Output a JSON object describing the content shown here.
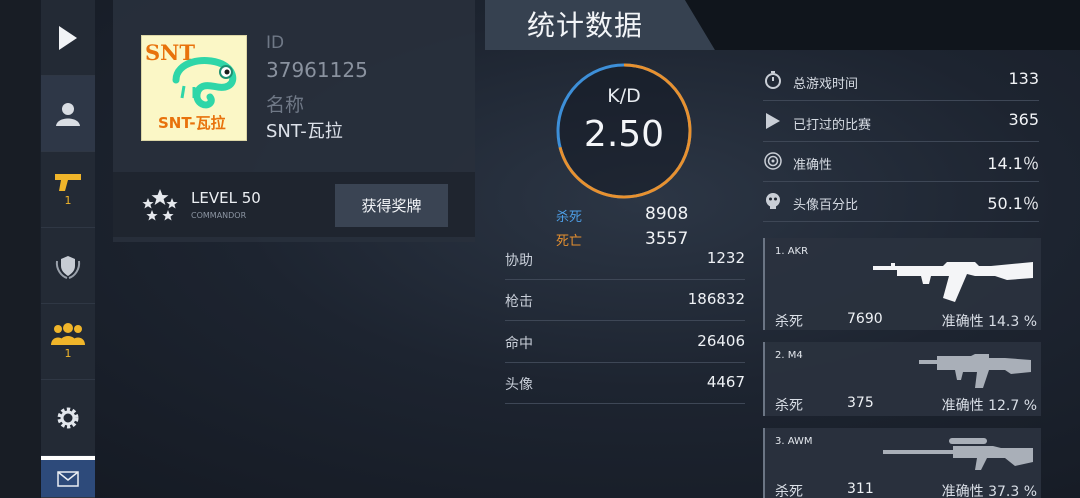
{
  "sidebar": {
    "play_icon": "play-icon",
    "profile_icon": "user-icon",
    "weapons_count": "1",
    "clan_count": "1",
    "settings_icon": "gear-icon",
    "mail_icon": "mail-icon"
  },
  "profile": {
    "logo_text": "SNT",
    "logo_sub": "SNT-瓦拉",
    "id_label": "ID",
    "id_value": "37961125",
    "name_label": "名称",
    "name_value": "SNT-瓦拉",
    "level": "LEVEL 50",
    "rank": "COMMANDOR",
    "award_button": "获得奖牌"
  },
  "stats": {
    "title": "统计数据",
    "kd_label": "K/D",
    "kd_value": "2.50",
    "kd_fraction": 0.71,
    "kills_label": "杀死",
    "kills_value": "8908",
    "deaths_label": "死亡",
    "deaths_value": "3557",
    "rows": [
      {
        "label": "协助",
        "value": "1232"
      },
      {
        "label": "枪击",
        "value": "186832"
      },
      {
        "label": "命中",
        "value": "26406"
      },
      {
        "label": "头像",
        "value": "4467"
      }
    ],
    "summary": [
      {
        "label": "总游戏时间",
        "value": "133",
        "icon": "stopwatch-icon"
      },
      {
        "label": "已打过的比赛",
        "value": "365",
        "icon": "play-icon"
      },
      {
        "label": "准确性",
        "value": "14.1％",
        "icon": "target-icon"
      },
      {
        "label": "头像百分比",
        "value": "50.1％",
        "icon": "headshot-icon"
      }
    ]
  },
  "weapons": [
    {
      "name": "1. AKR",
      "kills_label": "杀死",
      "kills": "7690",
      "acc": "准确性 14.3 %"
    },
    {
      "name": "2. M4",
      "kills_label": "杀死",
      "kills": "375",
      "acc": "准确性 12.7 %"
    },
    {
      "name": "3. AWM",
      "kills_label": "杀死",
      "kills": "311",
      "acc": "准确性 37.3 %"
    }
  ],
  "colors": {
    "accent_blue": "#3d8fd8",
    "accent_orange": "#e8912f",
    "logo_green": "#2fd6a8",
    "logo_orange": "#e8720c"
  }
}
